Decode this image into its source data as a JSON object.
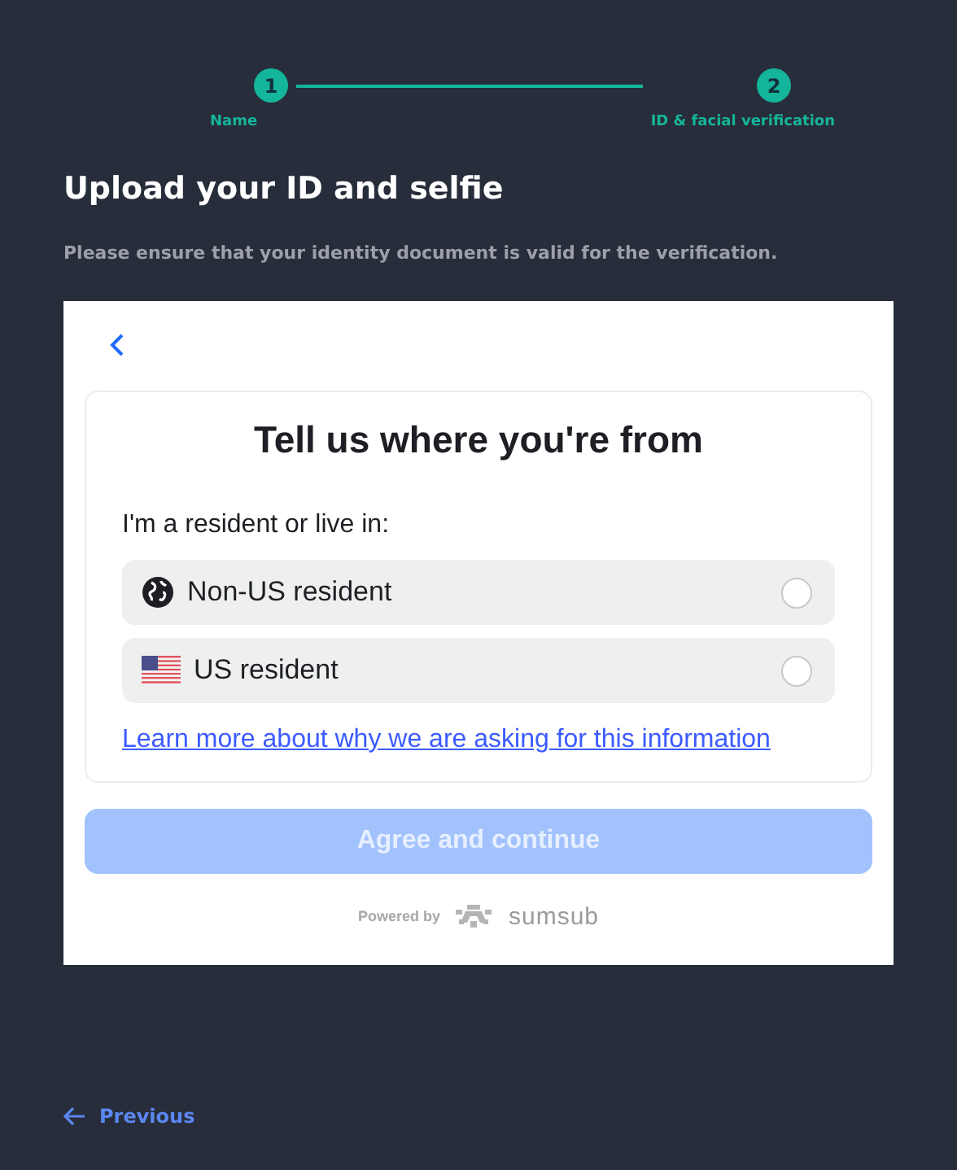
{
  "stepper": {
    "steps": [
      {
        "number": "1",
        "label": "Name"
      },
      {
        "number": "2",
        "label": "ID & facial verification"
      }
    ]
  },
  "title": "Upload your ID and selfie",
  "subtitle": "Please ensure that your identity document is valid for the verification.",
  "widget": {
    "heading": "Tell us where you're from",
    "prompt": "I'm a resident or live in:",
    "options": [
      {
        "kind": "globe",
        "label": "Non-US resident",
        "selected": false
      },
      {
        "kind": "flag",
        "label": "US resident",
        "selected": false
      }
    ],
    "link": "Learn more about why we are asking for this information",
    "button": {
      "label": "Agree and continue",
      "disabled": true
    },
    "powered_by": "Powered by",
    "brand": "sumsub"
  },
  "previous": "Previous"
}
